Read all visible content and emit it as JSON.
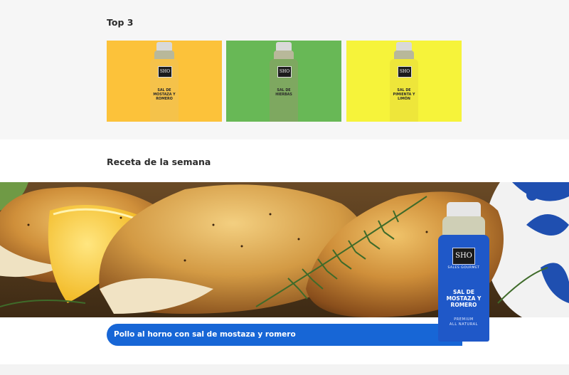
{
  "top3": {
    "title": "Top 3",
    "products": [
      {
        "name": "SAL DE MOSTAZA Y ROMERO",
        "logo": "SHO",
        "card_color": "#fcc23a",
        "bottle_color": "#f5c24a"
      },
      {
        "name": "SAL DE HIERBAS",
        "logo": "SHO",
        "card_color": "#68b856",
        "bottle_color": "#7ea860"
      },
      {
        "name": "SAL DE PIMIENTA Y LIMÓN",
        "logo": "SHO",
        "card_color": "#f6f33a",
        "bottle_color": "#eee63a"
      }
    ]
  },
  "recipe": {
    "title": "Receta de la semana",
    "button_label": "Pollo al horno con sal de mostaza y romero",
    "chevron_icon": "chevron-right-icon",
    "featured_product": {
      "logo": "SHO",
      "brand": "SALES GOURMET",
      "name": "SAL DE MOSTAZA Y ROMERO",
      "premium": "PREMIUM",
      "tagline": "ALL NATURAL"
    }
  },
  "colors": {
    "accent": "#1766d6",
    "top_section_bg": "#f6f6f6",
    "title_text": "#2b2b2b"
  }
}
